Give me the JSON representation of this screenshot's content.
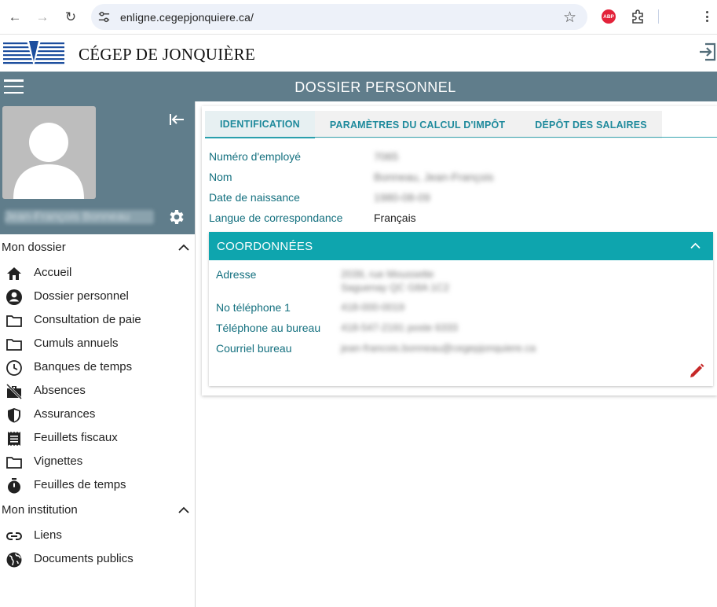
{
  "browser": {
    "url": "enligne.cegepjonquiere.ca/",
    "back_icon": "←",
    "forward_icon": "→",
    "reload_icon": "↻",
    "star_icon": "☆",
    "adblock_label": "ABP"
  },
  "header": {
    "college_name": "CÉGEP DE JONQUIÈRE",
    "page_title": "DOSSIER PERSONNEL"
  },
  "profile": {
    "user_name": "Jean-François Bonneau"
  },
  "sidebar": {
    "section_mon_dossier": "Mon dossier",
    "items": [
      {
        "label": "Accueil",
        "icon": "home-icon"
      },
      {
        "label": "Dossier personnel",
        "icon": "account-circle-icon"
      },
      {
        "label": "Consultation de paie",
        "icon": "folder-icon"
      },
      {
        "label": "Cumuls annuels",
        "icon": "folder-icon"
      },
      {
        "label": "Banques de temps",
        "icon": "clock-icon"
      },
      {
        "label": "Absences",
        "icon": "work-off-icon"
      },
      {
        "label": "Assurances",
        "icon": "shield-icon"
      },
      {
        "label": "Feuillets fiscaux",
        "icon": "receipt-icon"
      },
      {
        "label": "Vignettes",
        "icon": "folder-icon"
      },
      {
        "label": "Feuilles de temps",
        "icon": "timer-icon"
      }
    ],
    "section_mon_institution": "Mon institution",
    "institution_items": [
      {
        "label": "Liens",
        "icon": "link-icon"
      },
      {
        "label": "Documents publics",
        "icon": "globe-icon"
      }
    ]
  },
  "tabs": [
    {
      "label": "IDENTIFICATION",
      "active": true
    },
    {
      "label": "PARAMÈTRES DU CALCUL D'IMPÔT",
      "active": false
    },
    {
      "label": "DÉPÔT DES SALAIRES",
      "active": false
    }
  ],
  "identification": {
    "employee_number_label": "Numéro d'employé",
    "employee_number_value": "7065",
    "name_label": "Nom",
    "name_value": "Bonneau, Jean-François",
    "birthdate_label": "Date de naissance",
    "birthdate_value": "1980-08-09",
    "language_label": "Langue de correspondance",
    "language_value": "Français"
  },
  "coordonnees": {
    "title": "COORDONNÉES",
    "address_label": "Adresse",
    "address_line1": "2039, rue Moussette",
    "address_line2": "Saguenay QC G8A 1C2",
    "phone1_label": "No téléphone 1",
    "phone1_value": "418-000-0019",
    "office_phone_label": "Téléphone au bureau",
    "office_phone_value": "418-547-2191 poste 6333",
    "office_email_label": "Courriel bureau",
    "office_email_value": "jean-francois.bonneau@cegepjonquiere.ca"
  },
  "colors": {
    "bar": "#607d8b",
    "teal": "#0ea5ae",
    "label_teal": "#14707f",
    "edit_red": "#c62828"
  }
}
